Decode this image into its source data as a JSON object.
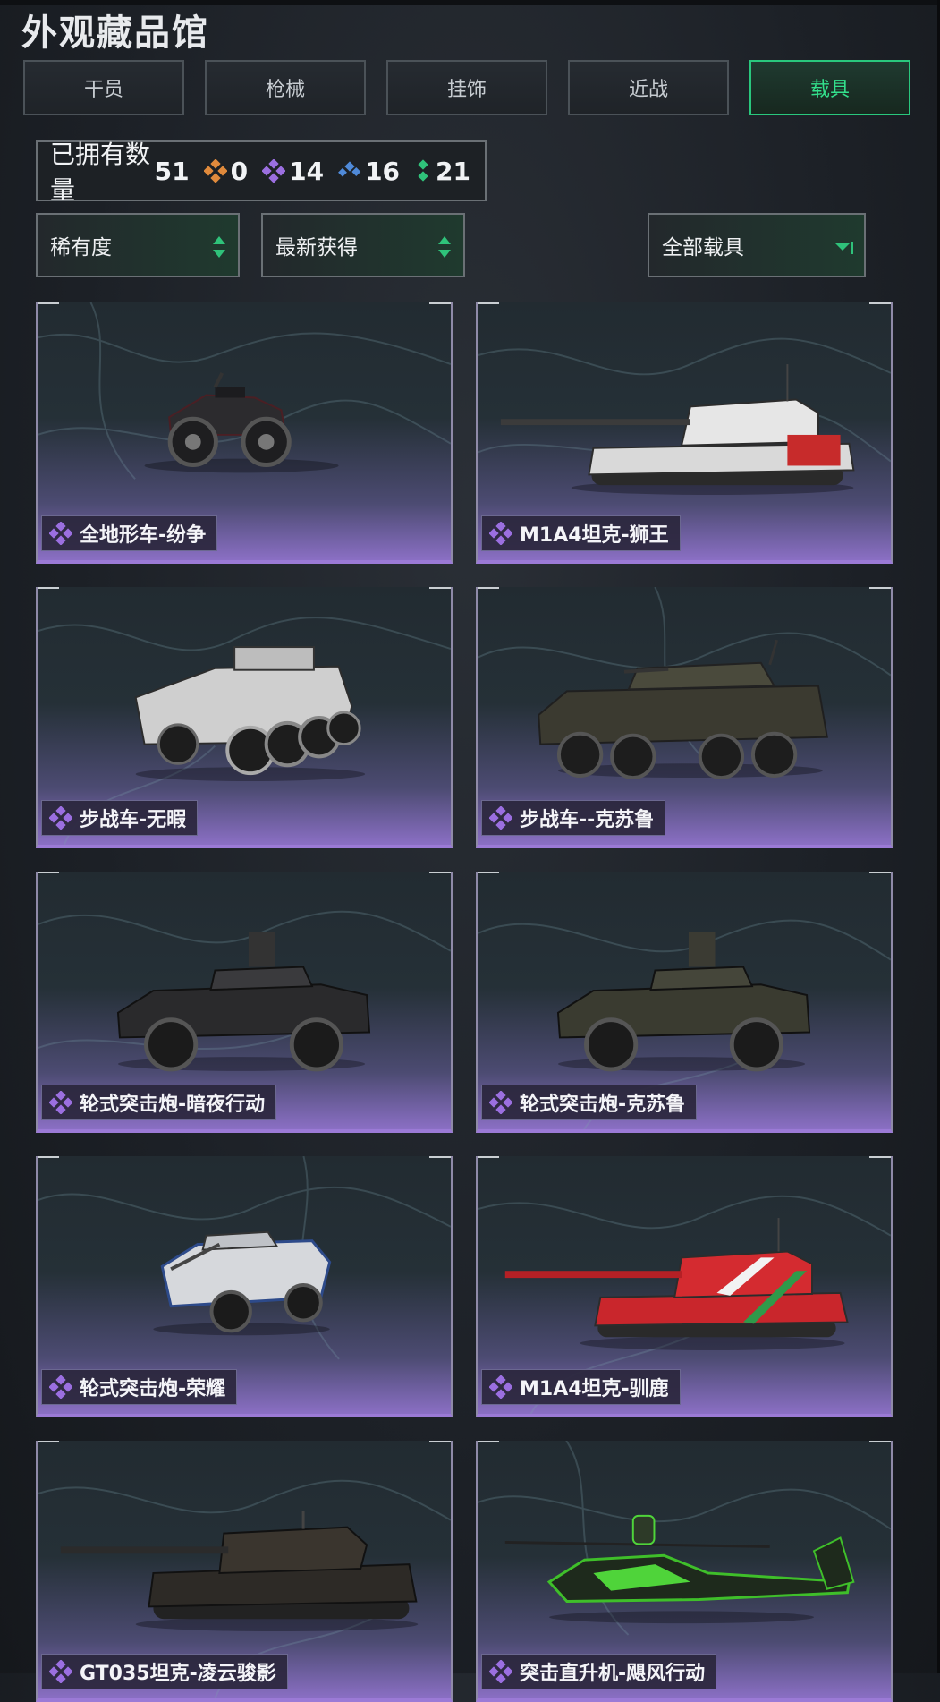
{
  "page_title": "外观藏品馆",
  "tabs": [
    {
      "label": "干员",
      "active": false
    },
    {
      "label": "枪械",
      "active": false
    },
    {
      "label": "挂饰",
      "active": false
    },
    {
      "label": "近战",
      "active": false
    },
    {
      "label": "载具",
      "active": true
    }
  ],
  "owned": {
    "label": "已拥有数量",
    "total": "51",
    "rarities": [
      {
        "icon": "orange-diamond-icon",
        "color": "#e08a3c",
        "count": "0"
      },
      {
        "icon": "purple-diamond-icon",
        "color": "#9b6fe0",
        "count": "14"
      },
      {
        "icon": "blue-diamond-icon",
        "color": "#4f8ad9",
        "count": "16"
      },
      {
        "icon": "green-diamond-icon",
        "color": "#2fc27a",
        "count": "21"
      }
    ]
  },
  "filters": {
    "rarity": "稀有度",
    "sort": "最新获得",
    "category": "全部载具"
  },
  "colors": {
    "accent": "#29c77d",
    "purple": "#9b6fe0"
  },
  "vehicles": [
    {
      "name": "全地形车-纷争",
      "icon": "atv"
    },
    {
      "name": "M1A4坦克-狮王",
      "icon": "tank"
    },
    {
      "name": "步战车-无暇",
      "icon": "ifv"
    },
    {
      "name": "步战车--克苏鲁",
      "icon": "ifv"
    },
    {
      "name": "轮式突击炮-暗夜行动",
      "icon": "armored-car"
    },
    {
      "name": "轮式突击炮-克苏鲁",
      "icon": "armored-car"
    },
    {
      "name": "轮式突击炮-荣耀",
      "icon": "armored-car"
    },
    {
      "name": "M1A4坦克-驯鹿",
      "icon": "tank"
    },
    {
      "name": "GT035坦克-凌云骏影",
      "icon": "tank"
    },
    {
      "name": "突击直升机-飓风行动",
      "icon": "helicopter"
    }
  ]
}
